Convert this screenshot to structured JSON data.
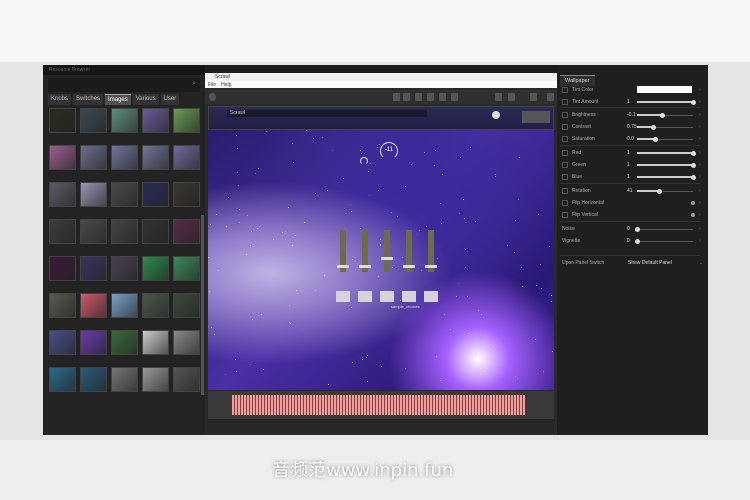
{
  "left_panel": {
    "title": "Resource Browser",
    "tabs": [
      "Knobs",
      "Switches",
      "Images",
      "Various",
      "User"
    ],
    "active_tab": "Images",
    "thumbnails": [
      "#2b2b20",
      "#3a4a55",
      "#5d8f7e",
      "#6b5a9a",
      "#6b9a55",
      "#9a5e8f",
      "#6a6f8f",
      "#70759a",
      "#6f7494",
      "#6e6a9a",
      "#5a5b66",
      "#9a94b5",
      "#4a4a4a",
      "#2b2a5a",
      "#3a3530",
      "#3d3d3d",
      "#4a4a4a",
      "#444",
      "#333",
      "#5a2a4a",
      "#3a1a3a",
      "#3a3460",
      "#4a4050",
      "#2a8a4a",
      "#3a8a5a",
      "#5a5a50",
      "#d05a6a",
      "#7aa0c8",
      "#4a5a4a",
      "#3a4a3a",
      "#4a4f8a",
      "#6a3ab0",
      "#3a6a3a",
      "#ccc",
      "#888",
      "#2a6a8a",
      "#2a5a7a",
      "#777",
      "#999",
      "#555"
    ]
  },
  "mid_window": {
    "title": "Scrawl",
    "menu": [
      "File",
      "Help"
    ],
    "instrument_name": "Scrawl",
    "knob_value": "-11",
    "sample_label": "sample_choices",
    "faders": [
      0.1,
      0.1,
      0.3,
      0.1,
      0.1
    ]
  },
  "right_panel": {
    "tab": "Wallpaper",
    "rows": [
      {
        "label": "Tint Color",
        "type": "color",
        "color": "#ffffff"
      },
      {
        "label": "Tint Amount",
        "value": "1",
        "fill": 1
      },
      {
        "label": "Brightness",
        "value": "-0.1",
        "fill": 0.45
      },
      {
        "label": "Contrast",
        "value": "0.75",
        "fill": 0.28
      },
      {
        "label": "Saturation",
        "value": "0.0",
        "fill": 0.33
      },
      {
        "label": "Red",
        "value": "1",
        "fill": 1
      },
      {
        "label": "Green",
        "value": "1",
        "fill": 1
      },
      {
        "label": "Blue",
        "value": "1",
        "fill": 1
      },
      {
        "label": "Rotation",
        "value": "41",
        "fill": 0.4
      },
      {
        "label": "Flip Horizontal",
        "type": "toggle"
      },
      {
        "label": "Flip Vertical",
        "type": "toggle"
      },
      {
        "label": "Noise",
        "value": "0",
        "fill": 0
      },
      {
        "label": "Vignette",
        "value": "0",
        "fill": 0
      }
    ],
    "panel_switch": {
      "label": "Upon Panel Switch",
      "value": "Show Default Panel"
    }
  },
  "watermark": "音频范www.inpin.fun"
}
